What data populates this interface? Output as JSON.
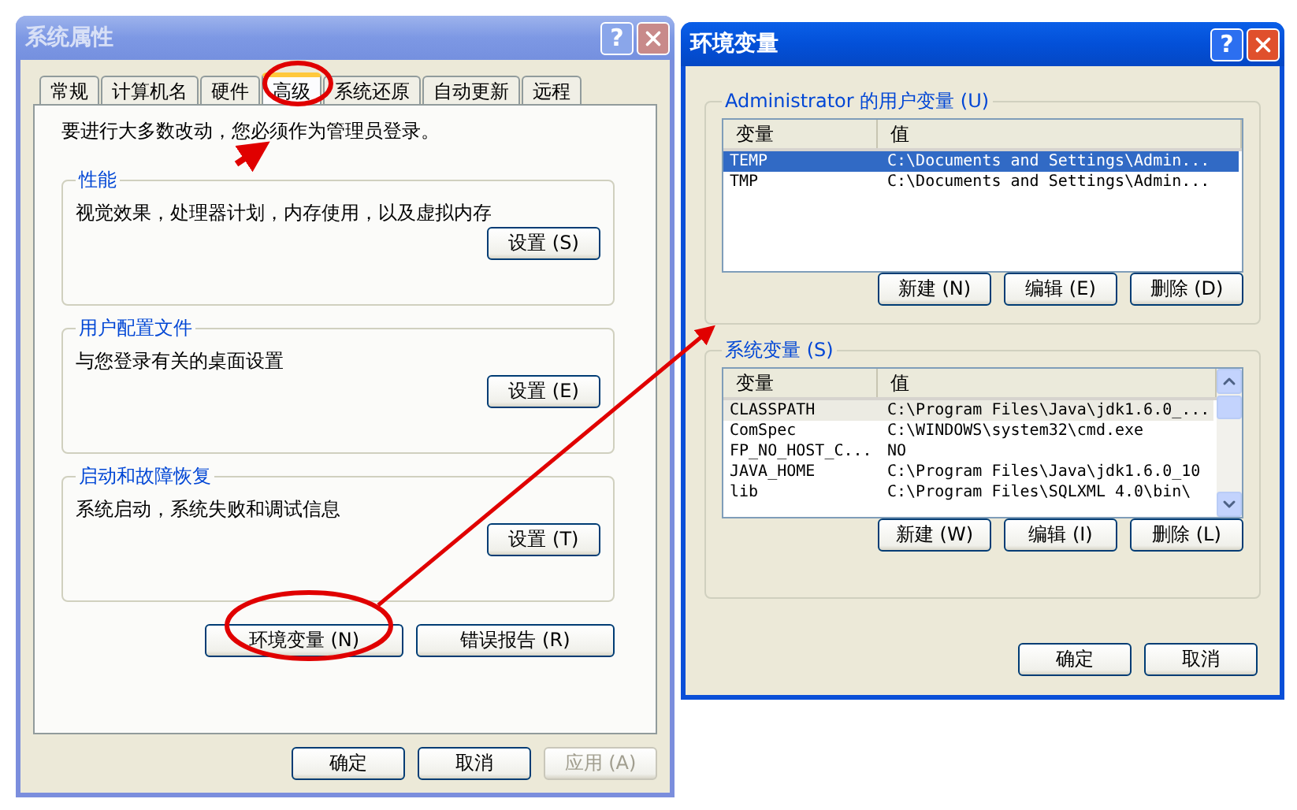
{
  "system_properties": {
    "title": "系统属性",
    "active": false,
    "help": "?",
    "tabs": [
      {
        "label": "常规",
        "selected": false
      },
      {
        "label": "计算机名",
        "selected": false
      },
      {
        "label": "硬件",
        "selected": false
      },
      {
        "label": "高级",
        "selected": true
      },
      {
        "label": "系统还原",
        "selected": false
      },
      {
        "label": "自动更新",
        "selected": false
      },
      {
        "label": "远程",
        "selected": false
      }
    ],
    "notice": "要进行大多数改动，您必须作为管理员登录。",
    "groups": [
      {
        "title": "性能",
        "text": "视觉效果，处理器计划，内存使用，以及虚拟内存",
        "button": "设置 (S)"
      },
      {
        "title": "用户配置文件",
        "text": "与您登录有关的桌面设置",
        "button": "设置 (E)"
      },
      {
        "title": "启动和故障恢复",
        "text": "系统启动，系统失败和调试信息",
        "button": "设置 (T)"
      }
    ],
    "extra_buttons": [
      "环境变量 (N)",
      "错误报告 (R)"
    ],
    "footer_buttons": [
      {
        "label": "确定",
        "disabled": false
      },
      {
        "label": "取消",
        "disabled": false
      },
      {
        "label": "应用 (A)",
        "disabled": true
      }
    ]
  },
  "environment_variables": {
    "title": "环境变量",
    "active": true,
    "help": "?",
    "sections": [
      {
        "title": "Administrator 的用户变量 (U)",
        "focused": true,
        "scrollbar": false,
        "columns": [
          "变量",
          "值"
        ],
        "rows": [
          {
            "name": "TEMP",
            "value": "C:\\Documents and Settings\\Admin...",
            "selected": true
          },
          {
            "name": "TMP",
            "value": "C:\\Documents and Settings\\Admin...",
            "selected": false
          }
        ],
        "buttons": [
          "新建 (N)",
          "编辑 (E)",
          "删除 (D)"
        ]
      },
      {
        "title": "系统变量 (S)",
        "focused": false,
        "scrollbar": true,
        "columns": [
          "变量",
          "值"
        ],
        "rows": [
          {
            "name": "CLASSPATH",
            "value": "C:\\Program Files\\Java\\jdk1.6.0_...",
            "selected": true
          },
          {
            "name": "ComSpec",
            "value": "C:\\WINDOWS\\system32\\cmd.exe",
            "selected": false
          },
          {
            "name": "FP_NO_HOST_C...",
            "value": "NO",
            "selected": false
          },
          {
            "name": "JAVA_HOME",
            "value": "C:\\Program Files\\Java\\jdk1.6.0_10",
            "selected": false
          },
          {
            "name": "lib",
            "value": "C:\\Program Files\\SQLXML 4.0\\bin\\",
            "selected": false
          }
        ],
        "buttons": [
          "新建 (W)",
          "编辑 (I)",
          "删除 (L)"
        ]
      }
    ],
    "footer_buttons": [
      {
        "label": "确定",
        "disabled": false
      },
      {
        "label": "取消",
        "disabled": false
      }
    ]
  }
}
